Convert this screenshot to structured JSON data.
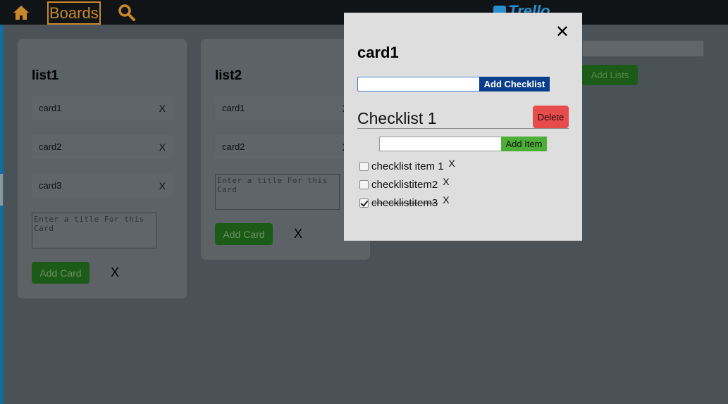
{
  "nav": {
    "boards_label": "Boards",
    "logo_text": "Trello"
  },
  "lists": [
    {
      "title": "list1",
      "cards": [
        "card1",
        "card2",
        "card3"
      ],
      "card_delete": "X",
      "textarea_placeholder": "Enter a title For this Card",
      "add_card_label": "Add Card",
      "close_label": "X"
    },
    {
      "title": "list2",
      "cards": [
        "card1",
        "card2"
      ],
      "card_delete": "X",
      "textarea_placeholder": "Enter a title For this Card",
      "add_card_label": "Add Card",
      "close_label": "X"
    }
  ],
  "add_lists_label": "Add Lists",
  "modal": {
    "close": "✕",
    "title": "card1",
    "add_checklist_label": "Add Checklist",
    "checklist": {
      "title": "Checklist 1",
      "delete_label": "Delete",
      "add_item_label": "Add Item",
      "items": [
        {
          "label": "checklist item 1",
          "checked": false,
          "remove": "X"
        },
        {
          "label": "checklistitem2",
          "checked": false,
          "remove": "X"
        },
        {
          "label": "checklistitem3",
          "checked": true,
          "remove": "X"
        }
      ]
    }
  },
  "colors": {
    "nav_bg": "#111416",
    "board_overlay": "#4a5258",
    "accent_orange": "#c9882b",
    "green_button": "#1c5a18",
    "checklist_button": "#0a3e8c",
    "delete_button": "#e84b4b",
    "add_item_button": "#4caf38"
  }
}
